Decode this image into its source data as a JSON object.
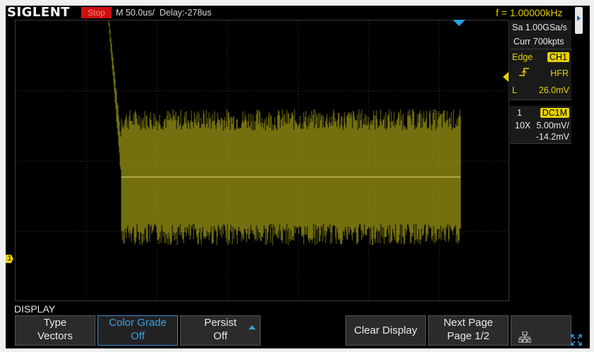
{
  "header": {
    "brand": "SIGLENT",
    "run_state": "Stop",
    "timebase": "M 50.0us/",
    "delay": "Delay:-278us",
    "frequency": "f = 1.00000kHz"
  },
  "acquisition": {
    "sample_rate": "Sa 1.00GSa/s",
    "memory": "Curr 700kpts"
  },
  "trigger": {
    "type": "Edge",
    "source": "CH1",
    "slope_icon": "rising-edge-icon",
    "coupling": "HFR",
    "level_label": "L",
    "level": "26.0mV"
  },
  "channel1": {
    "number": "1",
    "coupling": "DC1M",
    "probe": "10X",
    "scale": "5.00mV/",
    "offset": "-14.2mV",
    "ground_marker": "1"
  },
  "menu": {
    "title": "DISPLAY",
    "softkeys": [
      {
        "line1": "Type",
        "line2": "Vectors"
      },
      {
        "line1": "Color Grade",
        "line2": "Off"
      },
      {
        "line1": "Persist",
        "line2": "Off"
      },
      {
        "line1": "Clear Display"
      },
      {
        "line1": "Next Page",
        "line2": "Page 1/2"
      }
    ]
  },
  "colors": {
    "trace": "#d4cc1c",
    "trigger_marker": "#e6d200",
    "run_stop_badge": "#cc1010",
    "menu_highlight": "#3aa0e0"
  }
}
